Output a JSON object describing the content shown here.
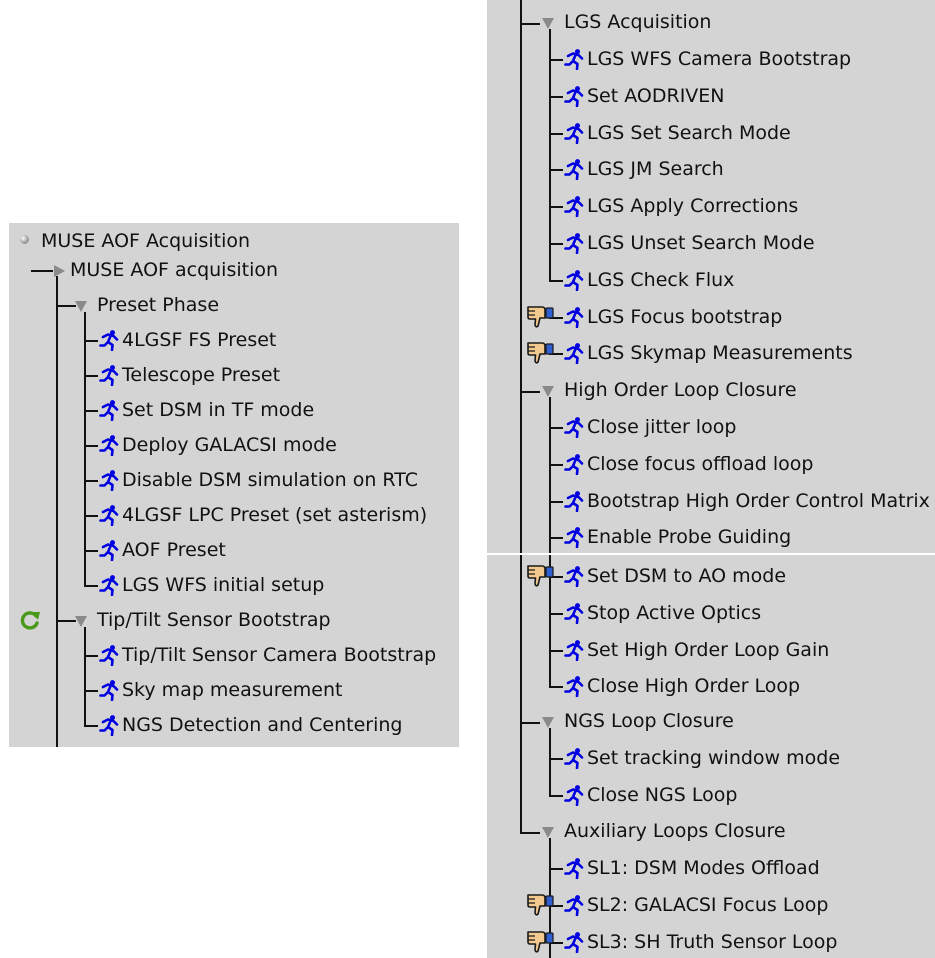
{
  "left_panel": {
    "root": "MUSE AOF Acquisition",
    "sequence": "MUSE AOF acquisition",
    "preset_phase": {
      "label": "Preset Phase",
      "items": [
        "4LGSF FS Preset",
        "Telescope Preset",
        "Set DSM in TF mode",
        "Deploy GALACSI mode",
        "Disable DSM simulation on RTC",
        "4LGSF LPC Preset (set asterism)",
        "AOF Preset",
        "LGS WFS initial setup"
      ]
    },
    "tiptilt_phase": {
      "label": "Tip/Tilt Sensor Bootstrap",
      "status_icon": "refresh-icon",
      "items": [
        "Tip/Tilt Sensor Camera Bootstrap",
        "Sky map measurement",
        "NGS Detection and Centering"
      ]
    }
  },
  "right_panel": {
    "lgs_acquisition": {
      "label": "LGS Acquisition",
      "items": [
        "LGS WFS Camera Bootstrap",
        "Set AODRIVEN",
        "LGS Set Search Mode",
        "LGS JM Search",
        "LGS Apply Corrections",
        "LGS Unset Search Mode",
        "LGS Check Flux",
        "LGS Focus bootstrap",
        "LGS Skymap Measurements"
      ]
    },
    "high_order": {
      "label": "High Order Loop Closure",
      "items": [
        "Close jitter loop",
        "Close focus offload loop",
        "Bootstrap High Order Control Matrix",
        "Enable Probe Guiding"
      ]
    },
    "high_order_cont": {
      "items": [
        "Set DSM to AO mode",
        "Stop Active Optics",
        "Set High Order Loop Gain",
        "Close High Order Loop"
      ]
    },
    "ngs_loop": {
      "label": "NGS Loop Closure",
      "items": [
        "Set tracking window mode",
        "Close NGS Loop"
      ]
    },
    "aux_loops": {
      "label": "Auxiliary Loops Closure",
      "items": [
        "SL1: DSM Modes Offload",
        "SL2: GALACSI Focus Loop",
        "SL3: SH Truth Sensor Loop"
      ]
    }
  },
  "icons": {
    "action": "running-man-icon",
    "interactive": "thumbs-down-hand-icon",
    "expanded": "triangle-down-icon",
    "collapsed": "triangle-right-icon",
    "root": "radio-dot-icon",
    "status_running": "refresh-icon"
  },
  "colors": {
    "panel_bg": "#d4d4d4",
    "action_icon": "#0000e0",
    "refresh_icon": "#4a9a1a",
    "triangle": "#8a8a8a"
  }
}
